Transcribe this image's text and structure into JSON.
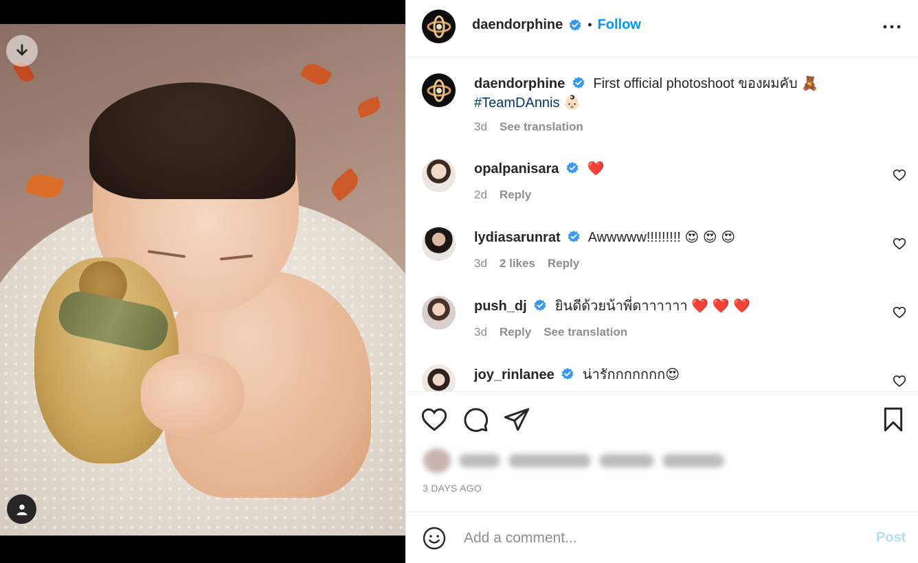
{
  "post": {
    "author": "daendorphine",
    "follow_label": "Follow",
    "header_separator": "•",
    "more_icon": "more-horizontal-icon",
    "caption": {
      "text": "First official photoshoot ของผมคับ 🧸",
      "hashtag": "#TeamDAnnis 👶🏻",
      "time": "3d",
      "see_translation": "See translation"
    }
  },
  "comments": [
    {
      "user": "opalpanisara",
      "verified": true,
      "text": "❤️",
      "time": "2d",
      "likes": "",
      "reply": "Reply",
      "see_translation": ""
    },
    {
      "user": "lydiasarunrat",
      "verified": true,
      "text": "Awwwww!!!!!!!!! 😍 😍 😍",
      "time": "3d",
      "likes": "2 likes",
      "reply": "Reply",
      "see_translation": ""
    },
    {
      "user": "push_dj",
      "verified": true,
      "text": "ยินดีด้วยน้าพี่ดาาาาาา ❤️ ❤️ ❤️",
      "time": "3d",
      "likes": "",
      "reply": "Reply",
      "see_translation": "See translation"
    },
    {
      "user": "joy_rinlanee",
      "verified": true,
      "text": "น่ารักกกกกกก😍",
      "time": "",
      "likes": "",
      "reply": "",
      "see_translation": ""
    }
  ],
  "actions": {
    "like_icon": "heart-icon",
    "comment_icon": "comment-icon",
    "share_icon": "share-icon",
    "save_icon": "bookmark-icon",
    "post_time": "3 DAYS AGO"
  },
  "add_comment": {
    "emoji_icon": "emoji-icon",
    "placeholder": "Add a comment...",
    "post_label": "Post"
  },
  "media": {
    "download_icon": "download-arrow-icon",
    "tag_icon": "user-tag-icon"
  },
  "colors": {
    "link_blue": "#0095f6",
    "post_disabled": "#b2dffc",
    "verified_blue": "#3897f0",
    "muted_text": "#8e8e8e"
  }
}
